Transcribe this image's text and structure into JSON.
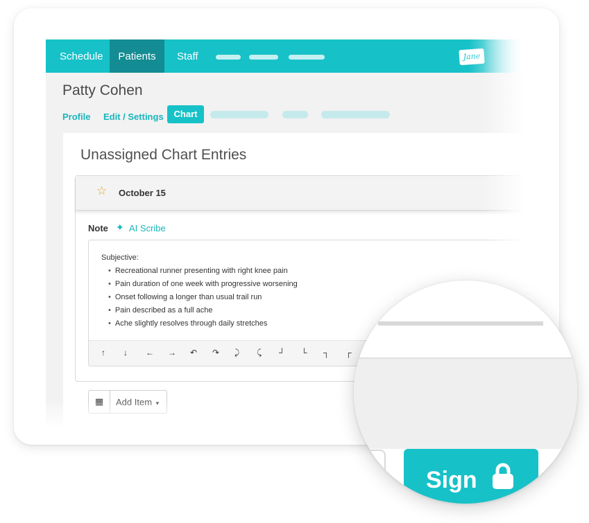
{
  "nav": {
    "items": [
      {
        "label": "Schedule"
      },
      {
        "label": "Patients"
      },
      {
        "label": "Staff"
      }
    ],
    "logo_text": "Jane"
  },
  "patient": {
    "name": "Patty Cohen"
  },
  "tabs": [
    {
      "label": "Profile"
    },
    {
      "label": "Edit / Settings"
    },
    {
      "label": "Chart"
    }
  ],
  "chart": {
    "title": "Unassigned Chart Entries",
    "entry": {
      "date": "October 15",
      "note_label": "Note",
      "ai_scribe_label": "AI Scribe",
      "section_heading": "Subjective:",
      "bullets": [
        "Recreational runner presenting with right knee pain",
        "Pain duration of one week with progressive worsening",
        "Onset following a longer than usual trail run",
        "Pain described as a full ache",
        "Ache slightly resolves through daily stretches"
      ],
      "toolbar": [
        "↑",
        "↓",
        "←",
        "→",
        "↶",
        "↷",
        "⤸",
        "⤹",
        "┘",
        "└",
        "┐",
        "┌"
      ]
    },
    "add_item_label": "Add Item"
  },
  "sign": {
    "label": "Sign"
  },
  "colors": {
    "brand": "#17c1c8",
    "nav_active": "#148c93",
    "star": "#e8a317"
  }
}
